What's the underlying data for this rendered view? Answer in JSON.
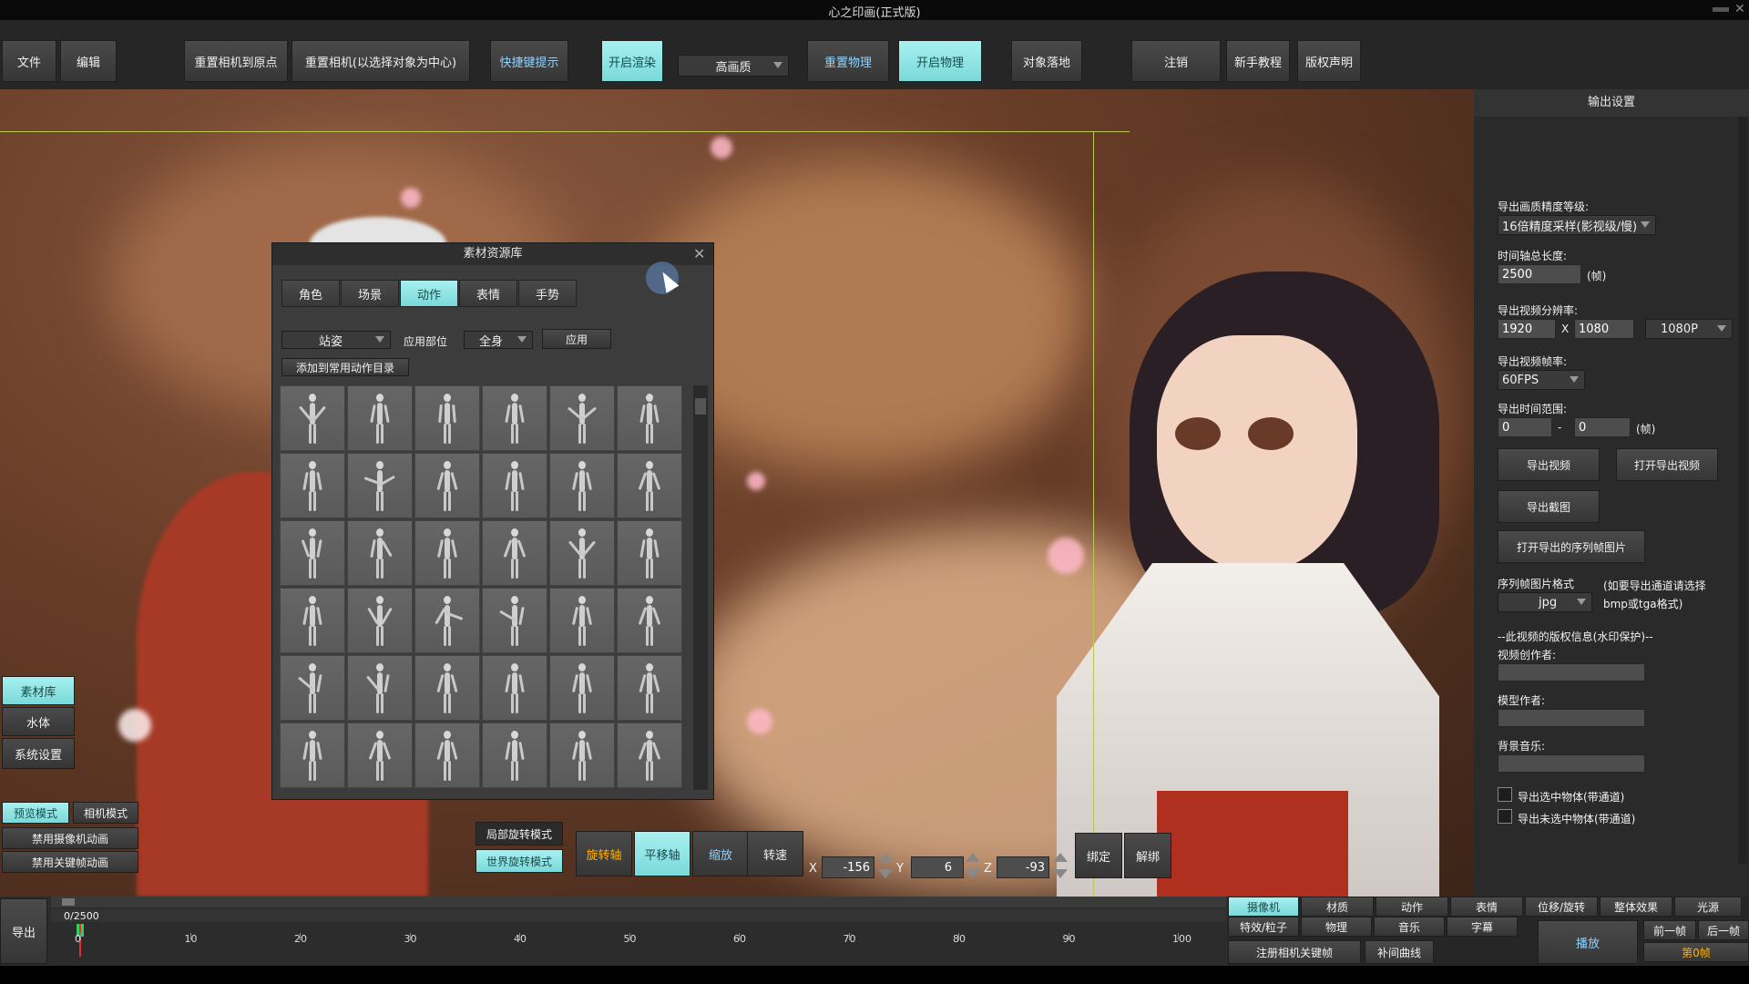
{
  "window": {
    "title": "心之印画(正式版)"
  },
  "toolbar": {
    "file": "文件",
    "edit": "编辑",
    "reset_camera_origin": "重置相机到原点",
    "reset_camera_center": "重置相机(以选择对象为中心)",
    "shortcut_hint": "快捷键提示",
    "enable_render": "开启渲染",
    "quality": "高画质",
    "reset_physics": "重置物理",
    "enable_physics": "开启物理",
    "object_ground": "对象落地",
    "logout": "注销",
    "tutorial": "新手教程",
    "copyright": "版权声明"
  },
  "library": {
    "title": "素材资源库",
    "tabs": [
      "角色",
      "场景",
      "动作",
      "表情",
      "手势"
    ],
    "active_tab": "动作",
    "pose_select": "站姿",
    "apply_part_label": "应用部位",
    "part_select": "全身",
    "apply_button": "应用",
    "add_common": "添加到常用动作目录"
  },
  "left_panel": {
    "material_lib": "素材库",
    "water": "水体",
    "system_settings": "系统设置",
    "preview_mode": "预览模式",
    "camera_mode": "相机模式",
    "disable_camera_anim": "禁用摄像机动画",
    "disable_keyframe_anim": "禁用关键帧动画"
  },
  "transform": {
    "local_rotate": "局部旋转模式",
    "world_rotate": "世界旋转模式",
    "rotate_axis": "旋转轴",
    "move_axis": "平移轴",
    "scale": "缩放",
    "speed": "转速",
    "x_label": "X",
    "x_value": "-156",
    "y_label": "Y",
    "y_value": "6",
    "z_label": "Z",
    "z_value": "-93",
    "bind": "绑定",
    "unbind": "解绑"
  },
  "output": {
    "title": "输出设置",
    "quality_label": "导出画质精度等级:",
    "quality_value": "16倍精度采样(影视级/慢)",
    "timeline_length_label": "时间轴总长度:",
    "timeline_length_value": "2500",
    "frames_unit": "(帧)",
    "resolution_label": "导出视频分辨率:",
    "res_w": "1920",
    "res_x": "X",
    "res_h": "1080",
    "res_preset": "1080P",
    "fps_label": "导出视频帧率:",
    "fps_value": "60FPS",
    "range_label": "导出时间范围:",
    "range_start": "0",
    "range_dash": "-",
    "range_end": "0",
    "export_video": "导出视频",
    "open_export_video": "打开导出视频",
    "export_screenshot": "导出截图",
    "open_sequence": "打开导出的序列帧图片",
    "seq_format_label": "序列帧图片格式",
    "seq_format_value": "jpg",
    "seq_note_1": "(如要导出通道请选择",
    "seq_note_2": "bmp或tga格式)",
    "copyright_label": "--此视频的版权信息(水印保护)--",
    "video_author_label": "视频创作者:",
    "model_author_label": "模型作者:",
    "bgm_label": "背景音乐:",
    "export_selected": "导出选中物体(带通道)",
    "export_unselected": "导出未选中物体(带通道)"
  },
  "timeline": {
    "export": "导出",
    "counter": "0/2500",
    "ticks": [
      "0",
      "10",
      "20",
      "30",
      "40",
      "50",
      "60",
      "70",
      "80",
      "90",
      "100"
    ]
  },
  "bottom_tabs": {
    "row1": [
      "摄像机",
      "材质",
      "动作",
      "表情",
      "位移/旋转",
      "整体效果",
      "光源"
    ],
    "row2": [
      "特效/粒子",
      "物理",
      "音乐",
      "字幕"
    ],
    "register_camera_key": "注册相机关键帧",
    "tween_curve": "补间曲线",
    "play": "播放",
    "prev_frame": "前一帧",
    "next_frame": "后一帧",
    "current_frame": "第0帧"
  }
}
